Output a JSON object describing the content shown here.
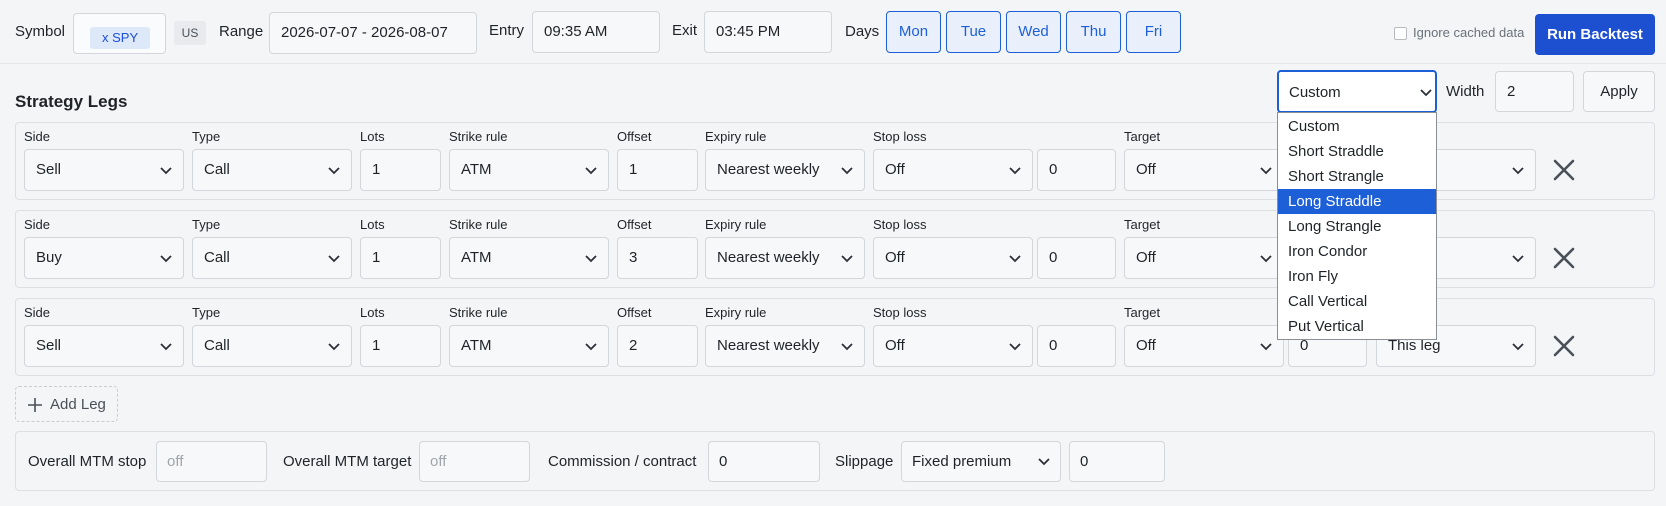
{
  "topbar": {
    "symbol_label": "Symbol",
    "symbol_chip": "x  SPY",
    "market_tag": "US",
    "range_label": "Range",
    "range_value": "2026-07-07 - 2026-08-07",
    "entry_label": "Entry",
    "entry_value": "09:35 AM",
    "exit_label": "Exit",
    "exit_value": "03:45 PM",
    "days_label": "Days",
    "days": [
      "Mon",
      "Tue",
      "Wed",
      "Thu",
      "Fri"
    ],
    "ignore_cache_label": "Ignore cached data",
    "ignore_cache_checked": false,
    "run_button": "Run Backtest",
    "accent": "#1d4fd1"
  },
  "strategy": {
    "title": "Strategy Legs",
    "preset_value": "Custom",
    "width_label": "Width",
    "width_value": "2",
    "apply_label": "Apply",
    "preset_options": [
      "Custom",
      "Short Straddle",
      "Short Strangle",
      "Long Straddle",
      "Long Strangle",
      "Iron Condor",
      "Iron Fly",
      "Call Vertical",
      "Put Vertical"
    ],
    "preset_highlighted": "Long Straddle"
  },
  "leg_labels": {
    "side": "Side",
    "type": "Type",
    "lots": "Lots",
    "strike_rule": "Strike rule",
    "offset": "Offset",
    "expiry_rule": "Expiry rule",
    "stop_loss": "Stop loss",
    "target": "Target"
  },
  "legs": [
    {
      "side": "Sell",
      "type": "Call",
      "lots": "1",
      "strike_rule": "ATM",
      "offset": "1",
      "expiry_rule": "Nearest weekly",
      "stop_loss": "Off",
      "stop_value": "0",
      "target": "Off",
      "target_value": "",
      "scope": ""
    },
    {
      "side": "Buy",
      "type": "Call",
      "lots": "1",
      "strike_rule": "ATM",
      "offset": "3",
      "expiry_rule": "Nearest weekly",
      "stop_loss": "Off",
      "stop_value": "0",
      "target": "Off",
      "target_value": "",
      "scope": ""
    },
    {
      "side": "Sell",
      "type": "Call",
      "lots": "1",
      "strike_rule": "ATM",
      "offset": "2",
      "expiry_rule": "Nearest weekly",
      "stop_loss": "Off",
      "stop_value": "0",
      "target": "Off",
      "target_value": "0",
      "scope": "This leg"
    }
  ],
  "add_leg_label": "Add Leg",
  "bottom": {
    "mtm_stop_label": "Overall MTM stop",
    "mtm_stop_placeholder": "off",
    "mtm_target_label": "Overall MTM target",
    "mtm_target_placeholder": "off",
    "commission_label": "Commission / contract",
    "commission_value": "0",
    "slippage_label": "Slippage",
    "slippage_mode": "Fixed premium",
    "slippage_value": "0"
  },
  "icons": {
    "chevron": "chevron-down-icon",
    "remove": "close-icon",
    "add": "plus-icon"
  }
}
